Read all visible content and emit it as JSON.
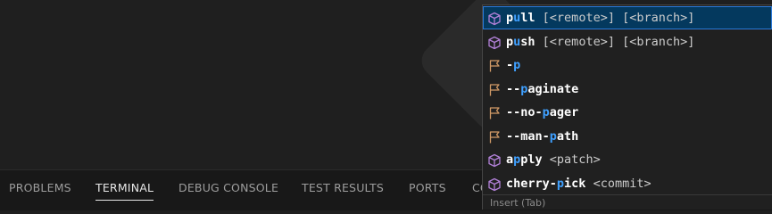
{
  "panel_tabs": [
    "PROBLEMS",
    "TERMINAL",
    "DEBUG CONSOLE",
    "TEST RESULTS",
    "PORTS",
    "CO"
  ],
  "active_tab": "TERMINAL",
  "suggestions": [
    {
      "icon": "cube-icon",
      "parts": [
        {
          "t": "p",
          "c": "kw"
        },
        {
          "t": "u",
          "c": "hl"
        },
        {
          "t": "ll",
          "c": "kw"
        },
        {
          "t": " [<remote>] [<branch>]",
          "c": "args"
        }
      ]
    },
    {
      "icon": "cube-icon",
      "parts": [
        {
          "t": "p",
          "c": "kw"
        },
        {
          "t": "u",
          "c": "hl"
        },
        {
          "t": "sh",
          "c": "kw"
        },
        {
          "t": " [<remote>] [<branch>]",
          "c": "args"
        }
      ]
    },
    {
      "icon": "flag-icon",
      "parts": [
        {
          "t": "-",
          "c": "kw"
        },
        {
          "t": "p",
          "c": "hl"
        }
      ]
    },
    {
      "icon": "flag-icon",
      "parts": [
        {
          "t": "--",
          "c": "kw"
        },
        {
          "t": "p",
          "c": "hl"
        },
        {
          "t": "aginate",
          "c": "kw"
        }
      ]
    },
    {
      "icon": "flag-icon",
      "parts": [
        {
          "t": "--no-",
          "c": "kw"
        },
        {
          "t": "p",
          "c": "hl"
        },
        {
          "t": "ager",
          "c": "kw"
        }
      ]
    },
    {
      "icon": "flag-icon",
      "parts": [
        {
          "t": "--man-",
          "c": "kw"
        },
        {
          "t": "p",
          "c": "hl"
        },
        {
          "t": "ath",
          "c": "kw"
        }
      ]
    },
    {
      "icon": "cube-icon",
      "parts": [
        {
          "t": "a",
          "c": "kw"
        },
        {
          "t": "p",
          "c": "hl"
        },
        {
          "t": "ply",
          "c": "kw"
        },
        {
          "t": " <patch>",
          "c": "args"
        }
      ]
    },
    {
      "icon": "cube-icon",
      "parts": [
        {
          "t": "cherry-",
          "c": "kw"
        },
        {
          "t": "p",
          "c": "hl"
        },
        {
          "t": "ick",
          "c": "kw"
        },
        {
          "t": " <commit>",
          "c": "args"
        }
      ]
    }
  ],
  "status_hint": "Insert (Tab)",
  "colors": {
    "cube": "#b180d7",
    "flag": "#d19a66",
    "match": "#3fa0ff"
  }
}
